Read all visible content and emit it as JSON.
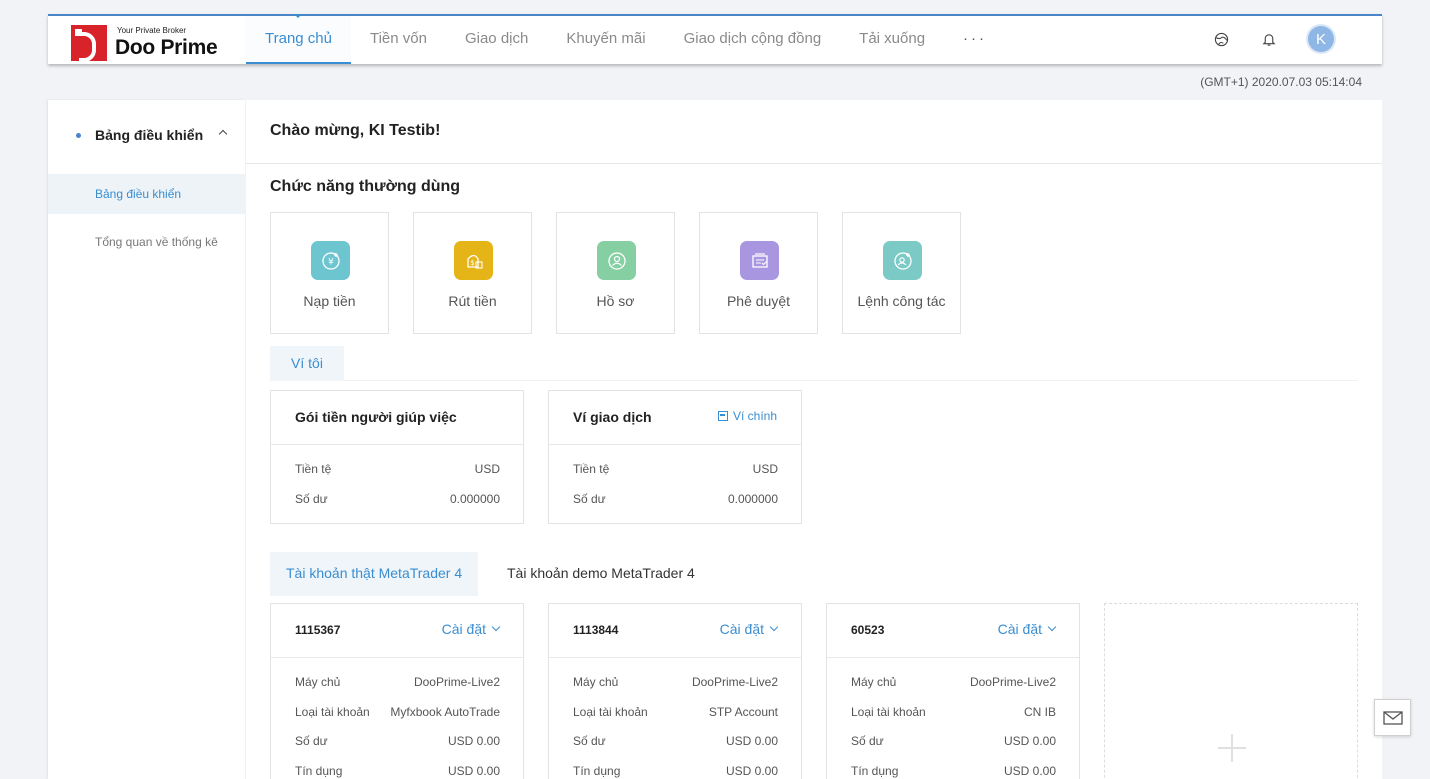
{
  "header": {
    "logo": {
      "tagline": "Your Private Broker",
      "brand": "Doo Prime"
    },
    "nav": [
      {
        "label": "Trang chủ",
        "active": true
      },
      {
        "label": "Tiền vốn",
        "active": false
      },
      {
        "label": "Giao dịch",
        "active": false
      },
      {
        "label": "Khuyến mãi",
        "active": false
      },
      {
        "label": "Giao dịch cộng đồng",
        "active": false
      },
      {
        "label": "Tải xuống",
        "active": false
      }
    ],
    "more_label": "···",
    "avatar_initial": "K",
    "icons": [
      "language-globe-icon",
      "bell-icon"
    ]
  },
  "timestamp": "(GMT+1) 2020.07.03 05:14:04",
  "sidebar": {
    "group_label": "Bảng điều khiển",
    "items": [
      {
        "label": "Bảng điều khiển",
        "active": true
      },
      {
        "label": "Tổng quan về thống kê",
        "active": false
      }
    ]
  },
  "main": {
    "welcome": "Chào mừng, KI Testib!",
    "common_functions_title": "Chức năng thường dùng",
    "functions": [
      {
        "label": "Nạp tiền",
        "icon": "deposit-icon",
        "color": "#6cc5cf"
      },
      {
        "label": "Rút tiền",
        "icon": "withdraw-icon",
        "color": "#e5b417"
      },
      {
        "label": "Hồ sơ",
        "icon": "profile-icon",
        "color": "#86cfa2"
      },
      {
        "label": "Phê duyệt",
        "icon": "approval-icon",
        "color": "#a996e0"
      },
      {
        "label": "Lệnh công tác",
        "icon": "work-order-icon",
        "color": "#7ccac6"
      }
    ],
    "wallet_tab": "Ví tôi",
    "wallets": [
      {
        "title": "Gói tiền người giúp việc",
        "link": "",
        "currency_label": "Tiền tệ",
        "currency": "USD",
        "balance_label": "Số dư",
        "balance": "0.000000"
      },
      {
        "title": "Ví giao dịch",
        "link": "Ví chính",
        "currency_label": "Tiền tệ",
        "currency": "USD",
        "balance_label": "Số dư",
        "balance": "0.000000"
      }
    ],
    "account_tabs": [
      {
        "label": "Tài khoản thật MetaTrader 4",
        "active": true
      },
      {
        "label": "Tài khoản demo MetaTrader 4",
        "active": false
      }
    ],
    "accounts": [
      {
        "number": "1115367",
        "settings": "Cài đặt",
        "rows": [
          {
            "label": "Máy chủ",
            "value": "DooPrime-Live2"
          },
          {
            "label": "Loại tài khoản",
            "value": "Myfxbook AutoTrade"
          },
          {
            "label": "Số dư",
            "value": "USD 0.00"
          },
          {
            "label": "Tín dụng",
            "value": "USD 0.00"
          }
        ]
      },
      {
        "number": "1113844",
        "settings": "Cài đặt",
        "rows": [
          {
            "label": "Máy chủ",
            "value": "DooPrime-Live2"
          },
          {
            "label": "Loại tài khoản",
            "value": "STP Account"
          },
          {
            "label": "Số dư",
            "value": "USD 0.00"
          },
          {
            "label": "Tín dụng",
            "value": "USD 0.00"
          }
        ]
      },
      {
        "number": "60523",
        "settings": "Cài đặt",
        "rows": [
          {
            "label": "Máy chủ",
            "value": "DooPrime-Live2"
          },
          {
            "label": "Loại tài khoản",
            "value": "CN IB"
          },
          {
            "label": "Số dư",
            "value": "USD 0.00"
          },
          {
            "label": "Tín dụng",
            "value": "USD 0.00"
          }
        ]
      }
    ]
  },
  "colors": {
    "accent": "#3a8dd0",
    "brand_red": "#d9232a"
  }
}
